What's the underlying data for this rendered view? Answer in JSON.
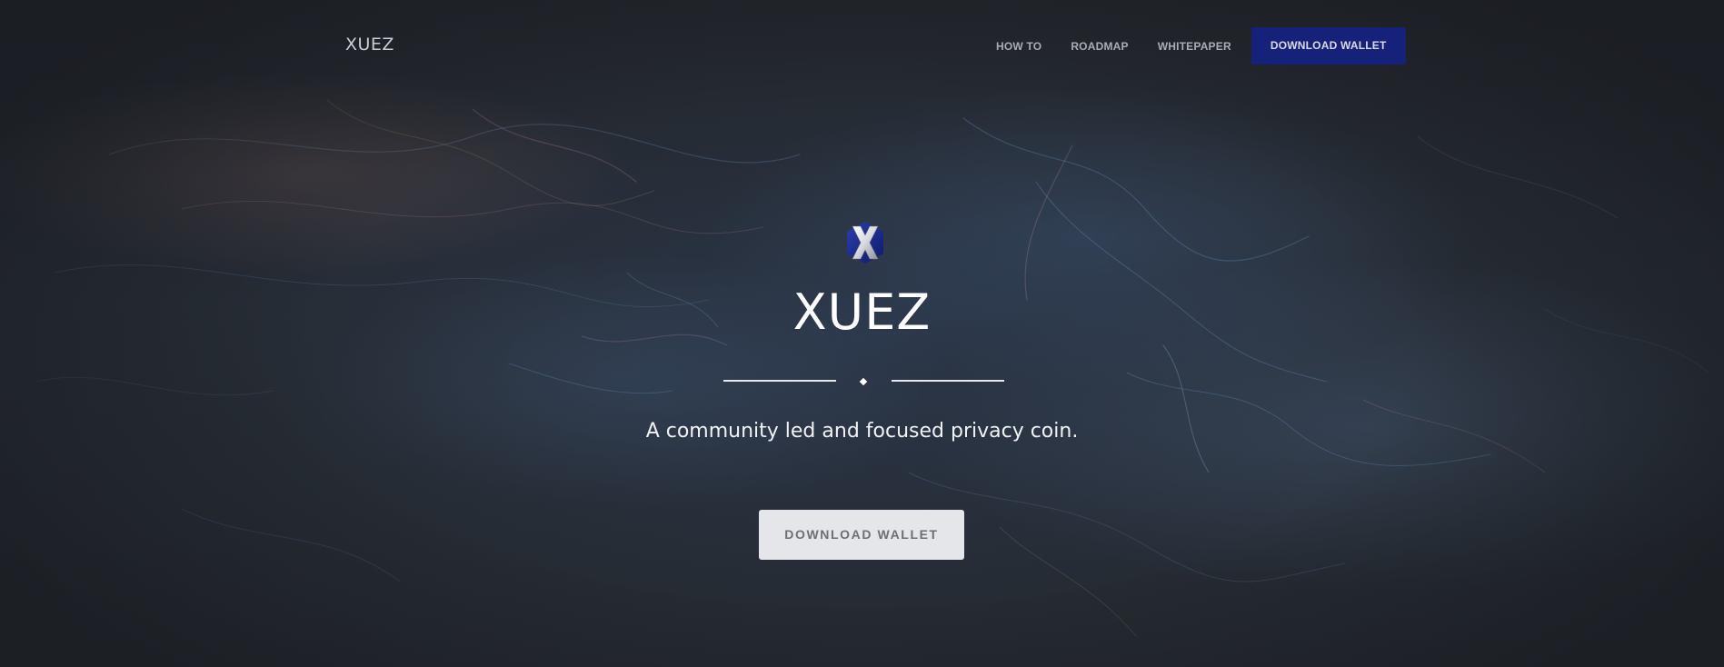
{
  "header": {
    "brand": "XUEZ",
    "nav": [
      {
        "label": "HOW TO"
      },
      {
        "label": "ROADMAP"
      },
      {
        "label": "WHITEPAPER"
      }
    ],
    "cta_label": "DOWNLOAD WALLET"
  },
  "hero": {
    "logo_icon": "xuez-x-logo-icon",
    "title": "XUEZ",
    "tagline": "A community led and focused privacy coin.",
    "cta_label": "DOWNLOAD WALLET"
  },
  "colors": {
    "background": "#262b33",
    "nav_cta": "#16217a",
    "hero_cta": "#e4e6e9",
    "title": "#ffffff"
  }
}
